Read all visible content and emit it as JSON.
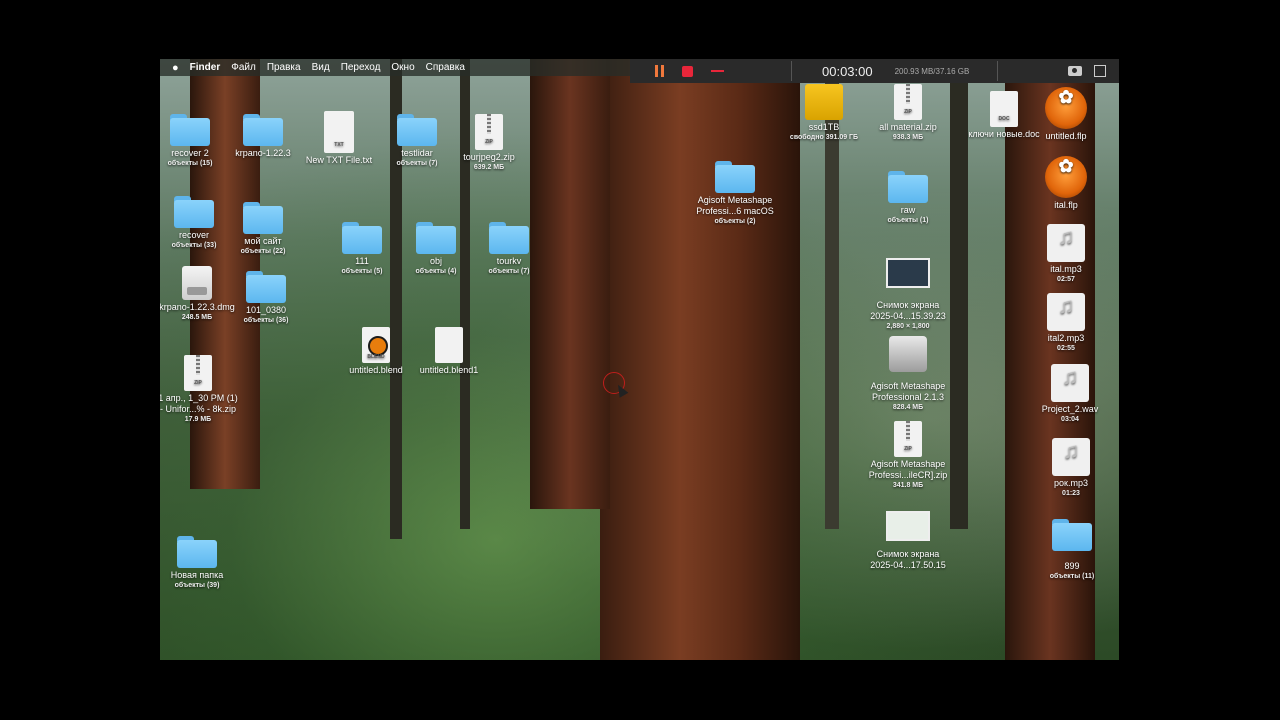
{
  "menubar": {
    "apple": "",
    "items": [
      "Finder",
      "Файл",
      "Правка",
      "Вид",
      "Переход",
      "Окно",
      "Справка"
    ]
  },
  "recorder": {
    "pause_icon": "pause-icon",
    "stop_icon": "stop-icon",
    "minimize_icon": "minus-icon",
    "time": "00:03:00",
    "storage": "200.93 МВ/37.16 GB",
    "camera_icon": "camera-icon",
    "edit_icon": "edit-icon"
  },
  "colors": {
    "folder": "#6cc2f4",
    "recorder_bg": "#2a2a2a",
    "record_red": "#e8263a",
    "pause_orange": "#f0783c"
  },
  "desktop": {
    "recover2": {
      "label": "recover 2",
      "sub": "объекты (15)"
    },
    "krpano": {
      "label": "krpano-1.22.3",
      "sub": ""
    },
    "newtxt": {
      "label": "New TXT File.txt",
      "sub": ""
    },
    "testlidar": {
      "label": "testlidar",
      "sub": "объекты (7)"
    },
    "tourjpeg2": {
      "label": "tourjpeg2.zip",
      "sub": "639.2 МБ"
    },
    "recover": {
      "label": "recover",
      "sub": "объекты (33)"
    },
    "moisait": {
      "label": "мой сайт",
      "sub": "объекты (22)"
    },
    "f111": {
      "label": "111",
      "sub": "объекты (5)"
    },
    "obj": {
      "label": "obj",
      "sub": "объекты (4)"
    },
    "tourkv": {
      "label": "tourkv",
      "sub": "объекты (7)"
    },
    "krpanodmg": {
      "label": "krpano-1.22.3.dmg",
      "sub": "248.5 МБ"
    },
    "f101": {
      "label": "101_0380",
      "sub": "объекты (36)"
    },
    "blend1": {
      "label": "untitled.blend",
      "sub": ""
    },
    "blend2": {
      "label": "untitled.blend1",
      "sub": ""
    },
    "zip8k": {
      "label": "1 апр., 1_30 PM (1)",
      "label2": "- Unifor...% - 8k.zip",
      "sub": "17.9 МБ"
    },
    "newfolder": {
      "label": "Новая папка",
      "sub": "объекты (39)"
    },
    "agisoftmac": {
      "label": "Agisoft Metashape",
      "label2": "Professi...6 macOS",
      "sub": "объекты (2)"
    },
    "ssd": {
      "label": "ssd1TB",
      "sub": "свободно 391.09 ГБ"
    },
    "allmaterial": {
      "label": "all material.zip",
      "sub": "938.3 МБ"
    },
    "klyuchi": {
      "label": "ключи новые.doc",
      "sub": ""
    },
    "untitledflp": {
      "label": "untitled.flp",
      "sub": ""
    },
    "raw": {
      "label": "raw",
      "sub": "объекты (1)"
    },
    "italflp": {
      "label": "ital.flp",
      "sub": ""
    },
    "snimok1": {
      "label": "Снимок экрана",
      "label2": "2025-04...15.39.23",
      "sub": "2,880 × 1,800"
    },
    "italmp3": {
      "label": "ital.mp3",
      "sub": "02:57"
    },
    "ital2mp3": {
      "label": "ital2.mp3",
      "sub": "02:55"
    },
    "agisoft213": {
      "label": "Agisoft Metashape",
      "label2": "Professional 2.1.3",
      "sub": "828.4 МБ"
    },
    "project2": {
      "label": "Project_2.wav",
      "sub": "03:04"
    },
    "agisoftzip": {
      "label": "Agisoft Metashape",
      "label2": "Professi...ileCR].zip",
      "sub": "341.8 МБ"
    },
    "rokmp3": {
      "label": "рок.mp3",
      "sub": "01:23"
    },
    "snimok2": {
      "label": "Снимок экрана",
      "label2": "2025-04...17.50.15",
      "sub": ""
    },
    "f899": {
      "label": "899",
      "sub": "объекты (11)"
    }
  }
}
